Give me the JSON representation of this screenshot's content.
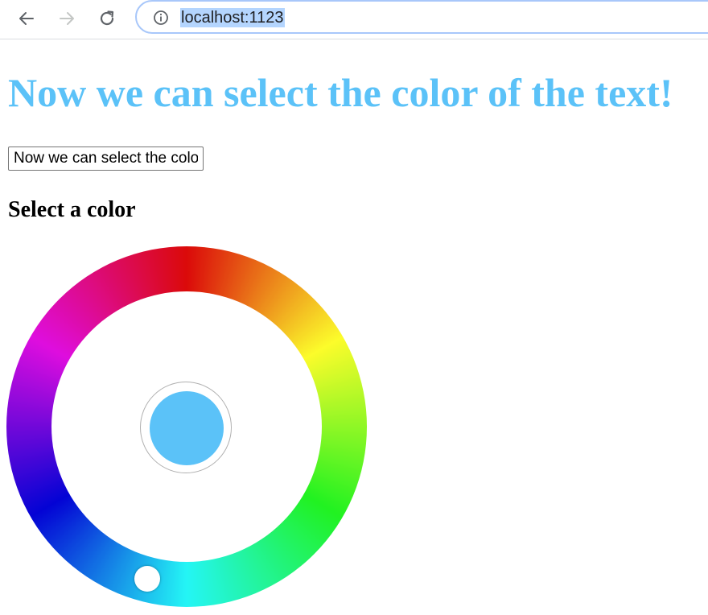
{
  "browser": {
    "url": "localhost:1123",
    "back_icon": "arrow-left-icon",
    "forward_icon": "arrow-right-icon",
    "reload_icon": "reload-icon",
    "site_info_icon": "info-icon"
  },
  "page": {
    "title": "Now we can select the color of the text!",
    "text_input_value": "Now we can select the color of the text!",
    "section_heading": "Select a color",
    "selected_color": "#5bc2f8"
  }
}
